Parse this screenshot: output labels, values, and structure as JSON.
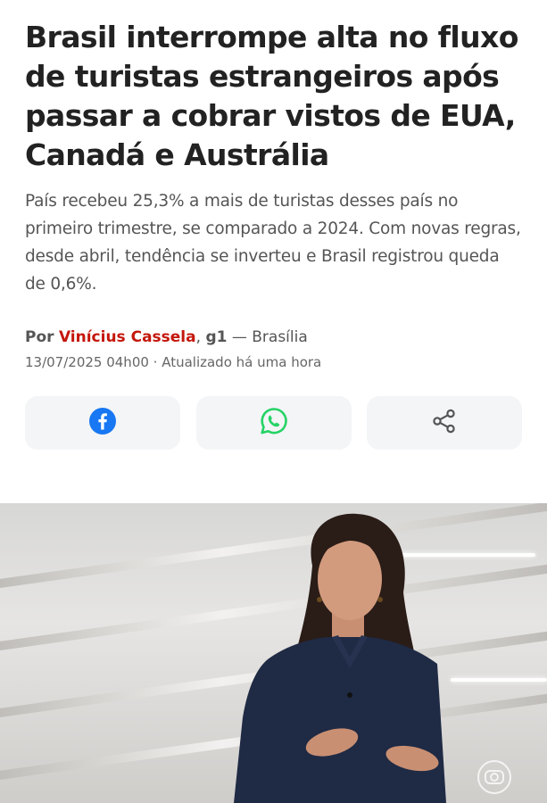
{
  "article": {
    "headline": "Brasil interrompe alta no fluxo de turistas estrangeiros após passar a cobrar vistos de EUA, Canadá e Austrália",
    "subtitle": "País recebeu 25,3% a mais de turistas desses país no primeiro trimestre, se comparado a 2024. Com novas regras, desde abril, tendência se inverteu e Brasil registrou queda de 0,6%.",
    "byline": {
      "prefix": "Por",
      "author": "Vinícius Cassela",
      "separator": ",",
      "agency": "g1",
      "location": "— Brasília"
    },
    "dateline": "13/07/2025 04h00 · Atualizado há uma hora"
  },
  "share": [
    {
      "icon": "facebook-icon",
      "color": "#1877f2"
    },
    {
      "icon": "whatsapp-icon",
      "color": "#25d366"
    },
    {
      "icon": "share-icon",
      "color": "#555555"
    }
  ],
  "video": {
    "watermark_icon": "globo-logo-icon"
  }
}
